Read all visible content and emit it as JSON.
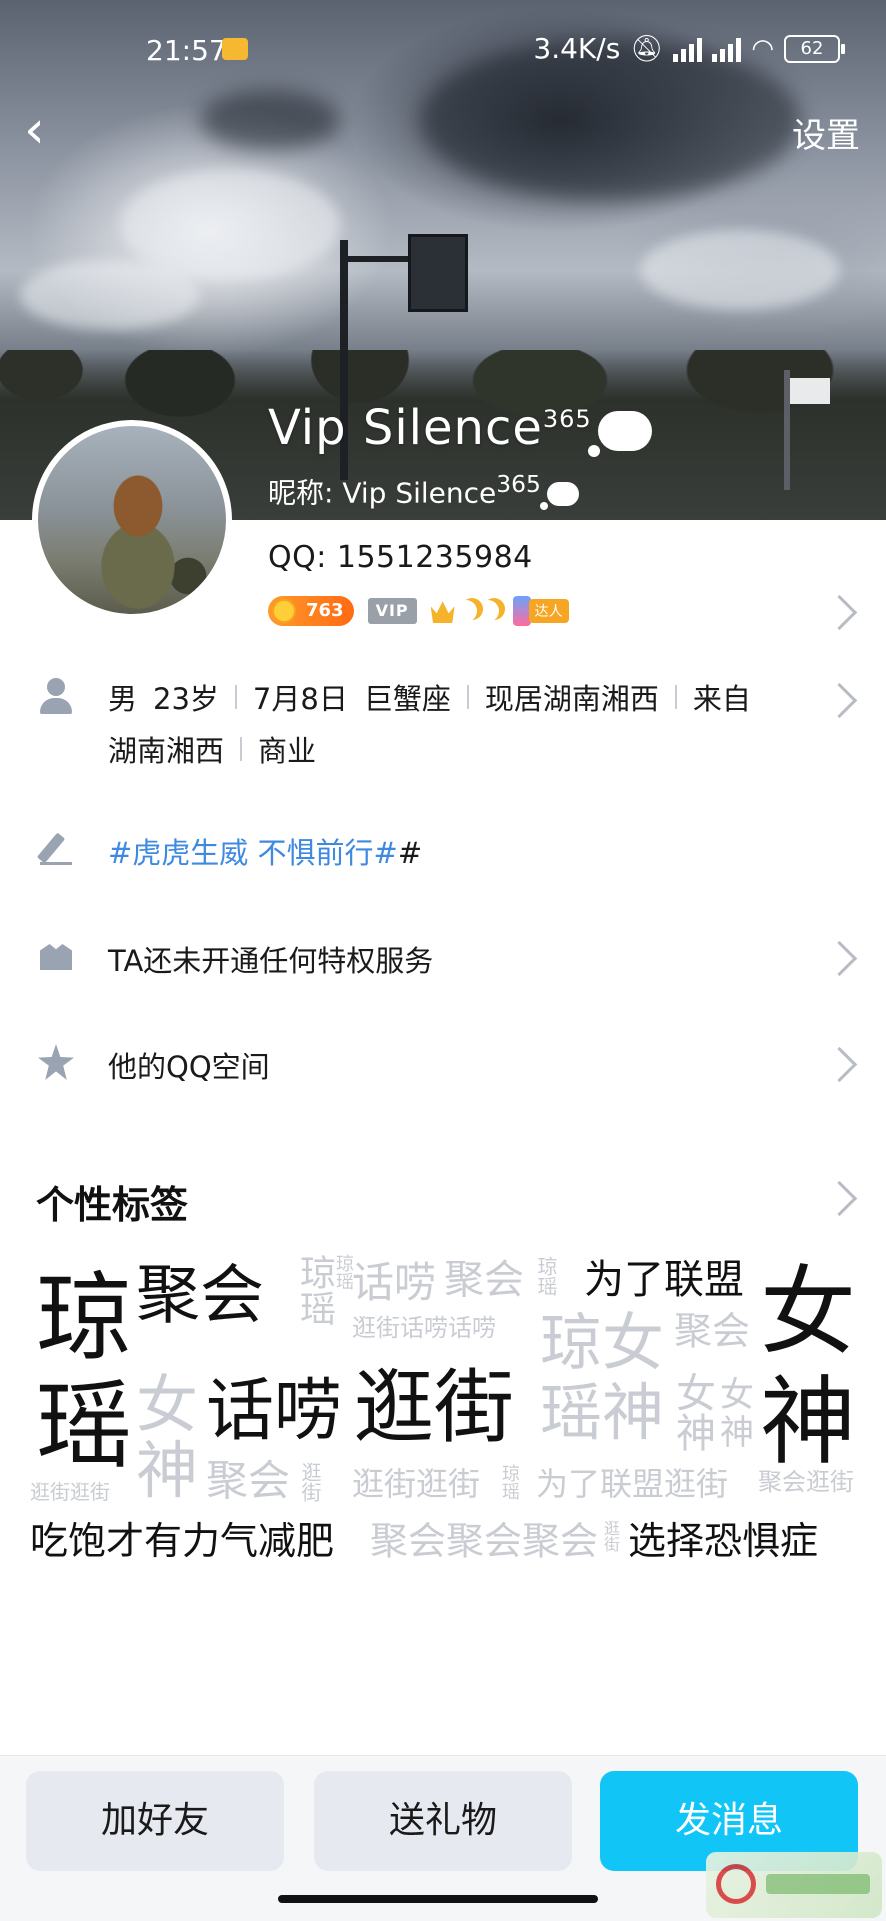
{
  "status_bar": {
    "time": "21:57",
    "network_speed": "3.4K/s",
    "battery": "62",
    "icons": [
      "mail-icon",
      "mute-icon",
      "hd-signal-icon",
      "hd-signal-icon",
      "wifi-icon",
      "battery-icon"
    ]
  },
  "header": {
    "back_icon": "chevron-left-icon",
    "back_glyph": "‹",
    "settings_label": "设置"
  },
  "profile": {
    "display_name": "Vip Silence",
    "display_name_sup": "365",
    "nickname_prefix": "昵称: ",
    "nickname": "Vip Silence",
    "nickname_sup": "365",
    "qq_label": "QQ: ",
    "qq_number": "1551235984",
    "badges": {
      "coin_level": "763",
      "vip_label": "VIP",
      "daren_label": "达人"
    }
  },
  "info": {
    "gender": "男",
    "age": "23岁",
    "birthday": "7月8日",
    "zodiac": "巨蟹座",
    "residence": "现居湖南湘西",
    "hometown_prefix": "来自",
    "hometown": "湖南湘西",
    "industry": "商业"
  },
  "signature": {
    "text": "#虎虎生威 不惧前行#",
    "trailing": "#"
  },
  "privilege_text": "TA还未开通任何特权服务",
  "qzone_text": "他的QQ空间",
  "tags_section": {
    "title": "个性标签"
  },
  "word_cloud": {
    "w1": "琼",
    "w2": "瑶",
    "w3": "聚会",
    "w4": "话唠",
    "w5": "逛街",
    "w6": "女",
    "w7": "神",
    "w8": "为了联盟",
    "w9": "女",
    "w10": "神",
    "w11": "吃饱才有力气减肥",
    "w12": "选择恐惧症",
    "l1": "琼瑶",
    "l2": "琼瑶",
    "l3": "话唠",
    "l4": "聚会",
    "l5": "琼瑶",
    "l6": "逛街话唠话唠",
    "l7": "琼女",
    "l8": "聚会",
    "l9": "女",
    "l10": "神",
    "l11": "瑶神",
    "l12": "女神",
    "l13": "聚会",
    "l14": "逛街",
    "l15": "逛街逛街",
    "l16": "琼瑶",
    "l17": "为了联盟逛街",
    "l18": "聚会逛街",
    "l19": "逛街逛街",
    "l20": "聚会聚会聚会",
    "l21": "逛街"
  },
  "actions": {
    "add_friend": "加好友",
    "send_gift": "送礼物",
    "send_message": "发消息"
  },
  "colors": {
    "accent": "#12c5f7",
    "signature": "#3f8ae0",
    "icon_gray": "#9aa3b2"
  }
}
